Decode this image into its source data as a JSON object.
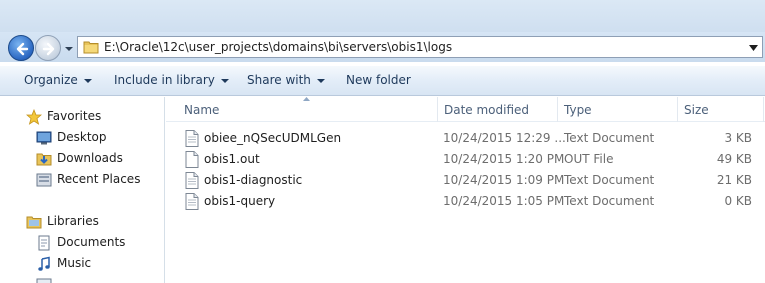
{
  "address": {
    "path": "E:\\Oracle\\12c\\user_projects\\domains\\bi\\servers\\obis1\\logs"
  },
  "toolbar": {
    "organize": "Organize",
    "include_in_library": "Include in library",
    "share_with": "Share with",
    "new_folder": "New folder"
  },
  "nav_pane": {
    "favorites": {
      "label": "Favorites",
      "items": [
        {
          "label": "Desktop",
          "icon": "desktop-icon"
        },
        {
          "label": "Downloads",
          "icon": "downloads-icon"
        },
        {
          "label": "Recent Places",
          "icon": "recent-places-icon"
        }
      ]
    },
    "libraries": {
      "label": "Libraries",
      "items": [
        {
          "label": "Documents",
          "icon": "documents-icon"
        },
        {
          "label": "Music",
          "icon": "music-icon"
        }
      ]
    }
  },
  "columns": {
    "name": "Name",
    "date_modified": "Date modified",
    "type": "Type",
    "size": "Size"
  },
  "files": [
    {
      "name": "obiee_nQSecUDMLGen",
      "date": "10/24/2015 12:29 ...",
      "type": "Text Document",
      "size": "3 KB"
    },
    {
      "name": "obis1.out",
      "date": "10/24/2015 1:20 PM",
      "type": "OUT File",
      "size": "49 KB"
    },
    {
      "name": "obis1-diagnostic",
      "date": "10/24/2015 1:09 PM",
      "type": "Text Document",
      "size": "21 KB"
    },
    {
      "name": "obis1-query",
      "date": "10/24/2015 1:05 PM",
      "type": "Text Document",
      "size": "0 KB"
    }
  ],
  "colors": {
    "toolbar_text": "#1e395b",
    "header_text": "#4c607a",
    "detail_text": "#6d6d6d"
  }
}
